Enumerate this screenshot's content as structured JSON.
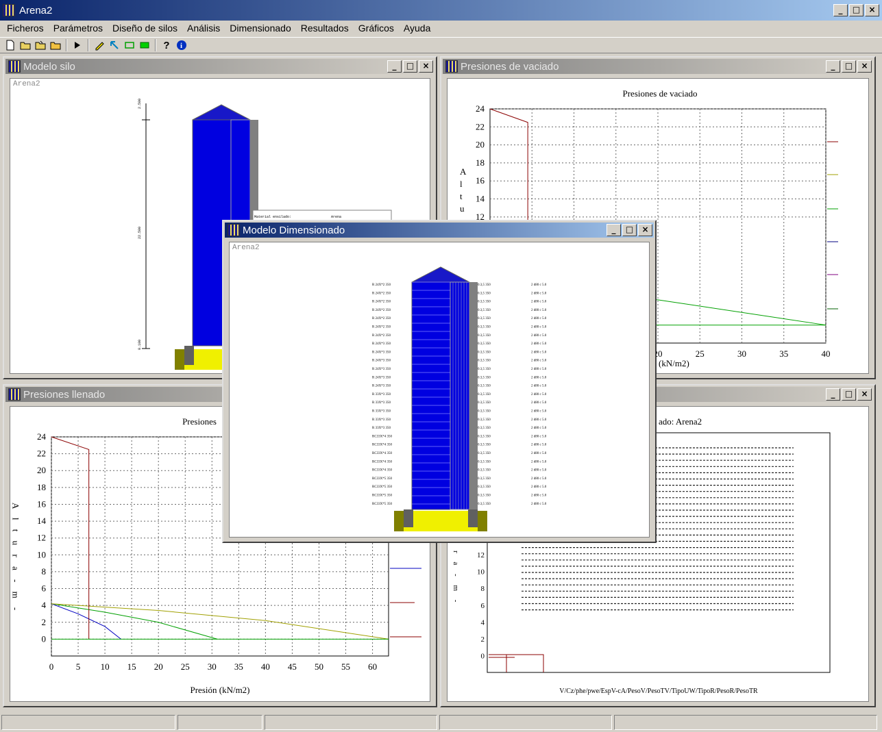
{
  "app": {
    "title": "Arena2",
    "min": "_",
    "max": "□",
    "close": "×"
  },
  "menu": [
    "Ficheros",
    "Parámetros",
    "Diseño de silos",
    "Análisis",
    "Dimensionado",
    "Resultados",
    "Gráficos",
    "Ayuda"
  ],
  "windows": {
    "modelo": {
      "title": "Modelo silo",
      "caption": "Arena2",
      "material_label": "Material ensilado:",
      "material_value": "Arena",
      "dim_top": "2.500",
      "dim_mid": "22.500",
      "dim_bot": "0.100"
    },
    "vaciado": {
      "title": "Presiones de vaciado",
      "chart_title": "Presiones de vaciado",
      "xlabel": "(kN/m2)",
      "yticks": [
        "24",
        "22",
        "20",
        "18",
        "16",
        "14",
        "12"
      ],
      "xticks": [
        "20",
        "25",
        "30",
        "35",
        "40"
      ]
    },
    "llenado": {
      "title": "Presiones llenado",
      "chart_title": "Presiones",
      "xlabel": "Presión (kN/m2)",
      "ylabel": "A l t u r a - m -",
      "yticks": [
        "24",
        "22",
        "20",
        "18",
        "16",
        "14",
        "12",
        "10",
        "8",
        "6",
        "4",
        "2",
        "0"
      ],
      "xticks": [
        "0",
        "5",
        "10",
        "15",
        "20",
        "25",
        "30",
        "35",
        "40",
        "45",
        "50",
        "55",
        "60"
      ]
    },
    "result": {
      "title_suffix": "ado: Arena2",
      "footer": "V/Cz/phe/pwe/EspV-cA/PesoV/PesoTV/TipoUW/TipoR/PesoR/PesoTR",
      "ylabel": "r a - m -",
      "yticks": [
        "12",
        "10",
        "8",
        "6",
        "4",
        "2",
        "0"
      ]
    },
    "dim": {
      "title": "Modelo Dimensionado",
      "caption": "Arena2"
    }
  },
  "dim_rows": {
    "left": [
      "R 24X*2 350",
      "R 24X*2 350",
      "R 24X*2 350",
      "R 24X*2 350",
      "R 24X*2 350",
      "R 24X*2 350",
      "R 24X*2 350",
      "R 24X*3 350",
      "R 24X*3 350",
      "R 24X*3 350",
      "R 24X*3 350",
      "R 24X*3 350",
      "R 24X*3 350",
      "R 33X*3 350",
      "R 33X*3 350",
      "R 33X*3 350",
      "R 33X*3 350",
      "R 33X*3 350",
      "RC33X*4 350",
      "RC33X*4 350",
      "RC33X*4 350",
      "RC33X*4 350",
      "RC33X*4 350",
      "RC33X*5 350",
      "RC33X*5 350",
      "RC33X*5 350",
      "RC33X*5 350"
    ],
    "mid": "0.3,5 350",
    "right": "2 d80 c 5.0"
  },
  "chart_data": [
    {
      "type": "line",
      "title": "Presiones de vaciado",
      "xlabel": "(kN/m2)",
      "xlim": [
        0,
        40
      ],
      "ylim": [
        0,
        24
      ],
      "series": [
        {
          "color": "#00a000",
          "x": [
            0,
            20,
            40
          ],
          "y": [
            3.8,
            2.8,
            0
          ]
        },
        {
          "color": "#8b0000",
          "x": [
            0,
            4.5,
            4.5
          ],
          "y": [
            24,
            22.5,
            0
          ]
        }
      ]
    },
    {
      "type": "line",
      "title": "Presiones",
      "xlabel": "Presión (kN/m2)",
      "ylabel": "Altura - m -",
      "xlim": [
        0,
        63
      ],
      "ylim": [
        0,
        24
      ],
      "series": [
        {
          "color": "#0000c0",
          "x": [
            0,
            5,
            10,
            13
          ],
          "y": [
            4.2,
            3,
            1.5,
            0
          ]
        },
        {
          "color": "#00a000",
          "x": [
            0,
            10,
            20,
            31
          ],
          "y": [
            4.2,
            3.2,
            2,
            0
          ]
        },
        {
          "color": "#a0a000",
          "x": [
            0,
            20,
            40,
            63
          ],
          "y": [
            4.2,
            3.4,
            2.2,
            0
          ]
        },
        {
          "color": "#8b0000",
          "x": [
            0,
            7,
            7
          ],
          "y": [
            24,
            22.5,
            0
          ]
        }
      ]
    }
  ],
  "status": [
    "",
    "",
    "",
    "",
    ""
  ]
}
